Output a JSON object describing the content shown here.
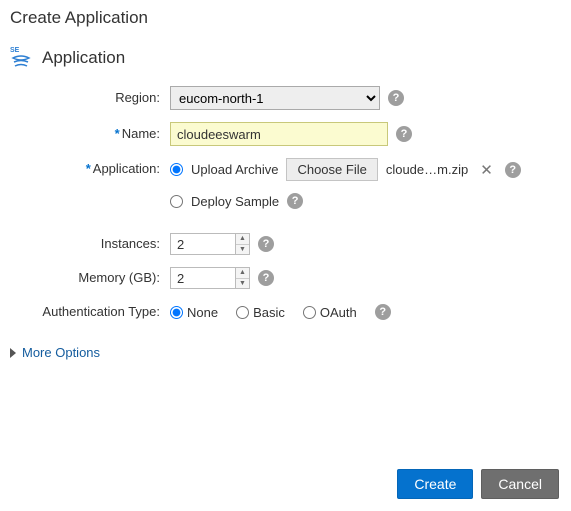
{
  "dialog": {
    "title": "Create Application"
  },
  "section": {
    "title": "Application"
  },
  "labels": {
    "region": "Region:",
    "name": "Name:",
    "application": "Application:",
    "instances": "Instances:",
    "memory": "Memory (GB):",
    "auth": "Authentication Type:"
  },
  "region": {
    "selected": "eucom-north-1",
    "options": [
      "eucom-north-1"
    ]
  },
  "name": {
    "value": "cloudeeswarm"
  },
  "upload": {
    "archive_label": "Upload Archive",
    "sample_label": "Deploy Sample",
    "choose_label": "Choose File",
    "filename": "cloude…m.zip",
    "selected": "archive"
  },
  "instances": {
    "value": "2"
  },
  "memory": {
    "value": "2"
  },
  "auth": {
    "options": [
      {
        "value": "none",
        "label": "None"
      },
      {
        "value": "basic",
        "label": "Basic"
      },
      {
        "value": "oauth",
        "label": "OAuth"
      }
    ],
    "selected": "none"
  },
  "more_options": {
    "label": "More Options"
  },
  "footer": {
    "create": "Create",
    "cancel": "Cancel"
  },
  "glyphs": {
    "help": "?",
    "clear": "✕",
    "up": "▲",
    "down": "▼"
  }
}
